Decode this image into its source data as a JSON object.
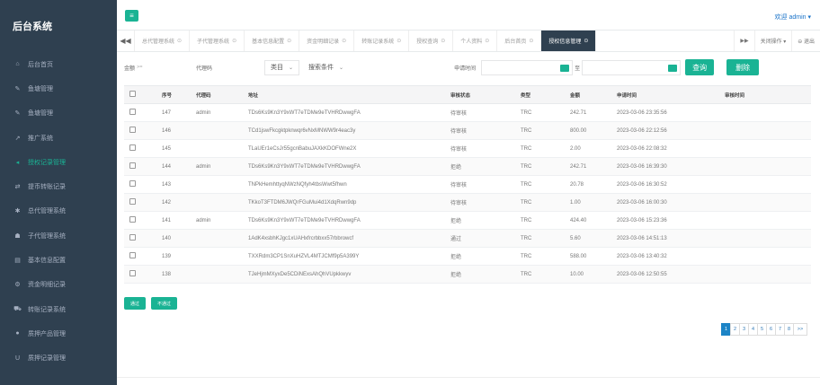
{
  "sidebar": {
    "brand": "后台系统",
    "items": [
      {
        "label": "后台首页",
        "icon": "home-icon",
        "glyph": "⌂",
        "active": false
      },
      {
        "label": "鱼塘管理",
        "icon": "wrench-icon",
        "glyph": "✎",
        "active": false
      },
      {
        "label": "鱼塘管理",
        "icon": "wrench-icon",
        "glyph": "✎",
        "active": false
      },
      {
        "label": "推广系统",
        "icon": "share-icon",
        "glyph": "↗",
        "active": false
      },
      {
        "label": "授权记录管理",
        "icon": "bullhorn-icon",
        "glyph": "◂",
        "active": true
      },
      {
        "label": "提币转账记录",
        "icon": "exchange-icon",
        "glyph": "⇄",
        "active": false
      },
      {
        "label": "总代管理系统",
        "icon": "asterisk-icon",
        "glyph": "✱",
        "active": false
      },
      {
        "label": "子代管理系统",
        "icon": "users-icon",
        "glyph": "☗",
        "active": false
      },
      {
        "label": "基本信息配置",
        "icon": "file-icon",
        "glyph": "▤",
        "active": false
      },
      {
        "label": "资金明细记录",
        "icon": "settings-icon",
        "glyph": "⚙",
        "active": false
      },
      {
        "label": "转账记录系统",
        "icon": "car-icon",
        "glyph": "⛟",
        "active": false
      },
      {
        "label": "质押产品管理",
        "icon": "comment-icon",
        "glyph": "●",
        "active": false
      },
      {
        "label": "质押记录管理",
        "icon": "magnet-icon",
        "glyph": "U",
        "active": false
      }
    ]
  },
  "topbar": {
    "menu_glyph": "≡",
    "user": "欢迎 admin ▾"
  },
  "tabs": {
    "back_glyph": "◀◀",
    "fwd_glyph": "▶▶",
    "items": [
      {
        "label": "总代管理系统",
        "active": false
      },
      {
        "label": "子代管理系统",
        "active": false
      },
      {
        "label": "基本信息配置",
        "active": false
      },
      {
        "label": "资金明细记录",
        "active": false
      },
      {
        "label": "转账记录系统",
        "active": false
      },
      {
        "label": "授权查询",
        "active": false
      },
      {
        "label": "个人资料",
        "active": false
      },
      {
        "label": "后台首页",
        "active": false
      },
      {
        "label": "授权信息管理",
        "active": true
      }
    ],
    "close_glyph": "⊙",
    "close_ops": "关闭操作 ▾",
    "logout": "⊖ 退出"
  },
  "filters": {
    "amount_label": "金额",
    "amount_op": ">=",
    "proxy_label": "代理码",
    "select_label": "类目",
    "search_label": "搜索条件",
    "time_label": "申请时间",
    "to_label": "至",
    "query_button": "查询",
    "delete_button": "删除"
  },
  "table": {
    "headers": [
      "",
      "序号",
      "代理码",
      "地址",
      "审核状态",
      "类型",
      "金额",
      "申请时间",
      "审核时间"
    ],
    "rows": [
      [
        "147",
        "admin",
        "TDs6Ks9Kn3Y9xWT7eTDMe9eTVHRDwwgFA",
        "待审核",
        "TRC",
        "242.71",
        "2023-03-06 23:35:56",
        ""
      ],
      [
        "146",
        "",
        "TCd1jswFkcgktpknwqr6vNxMNWW9r4eac3y",
        "待审核",
        "TRC",
        "800.00",
        "2023-03-06 22:12:56",
        ""
      ],
      [
        "145",
        "",
        "TLaUEr1eCsJr55gcnBabuJAXkKDOFWne2X",
        "待审核",
        "TRC",
        "2.00",
        "2023-03-06 22:08:32",
        ""
      ],
      [
        "144",
        "admin",
        "TDs6Ks9Kn3Y9xWT7eTDMe9eTVHRDwwgFA",
        "拒绝",
        "TRC",
        "242.71",
        "2023-03-06 16:39:30",
        ""
      ],
      [
        "143",
        "",
        "TNPkHemhttyqNWzNQfyh4tbsWwt5fhwn",
        "待审核",
        "TRC",
        "20.78",
        "2023-03-06 16:30:52",
        ""
      ],
      [
        "142",
        "",
        "TKkoT3FTDM6JWQrFGuMui4d1XdqRwn9dp",
        "待审核",
        "TRC",
        "1.00",
        "2023-03-06 16:00:30",
        ""
      ],
      [
        "141",
        "admin",
        "TDs6Ks9Kn3Y9xWT7eTDMe9eTVHRDwwgFA",
        "拒绝",
        "TRC",
        "424.40",
        "2023-03-06 15:23:36",
        ""
      ],
      [
        "140",
        "",
        "1AdK4xsbhKJgc1xUAHxfrcrbbxx57rbbrowcf",
        "通过",
        "TRC",
        "5.60",
        "2023-03-06 14:51:13",
        ""
      ],
      [
        "139",
        "",
        "TXXRdm3CP1SnXuHZVL4MTJCMf9p5A399Y",
        "拒绝",
        "TRC",
        "588.00",
        "2023-03-06 13:40:32",
        ""
      ],
      [
        "138",
        "",
        "TJeHjmMXyxDe5CDiNExsAhQhVUpkkwyv",
        "拒绝",
        "TRC",
        "10.00",
        "2023-03-06 12:50:55",
        ""
      ]
    ]
  },
  "actions": {
    "approve": "通过",
    "reject": "不通过"
  },
  "pagination": {
    "pages": [
      "1",
      "2",
      "3",
      "4",
      "5",
      "6",
      "7",
      "8"
    ],
    "next": ">>"
  },
  "colors": {
    "accent": "#1ab394",
    "sidebar_bg": "#2f4050",
    "page_active": "#1c84c6"
  }
}
